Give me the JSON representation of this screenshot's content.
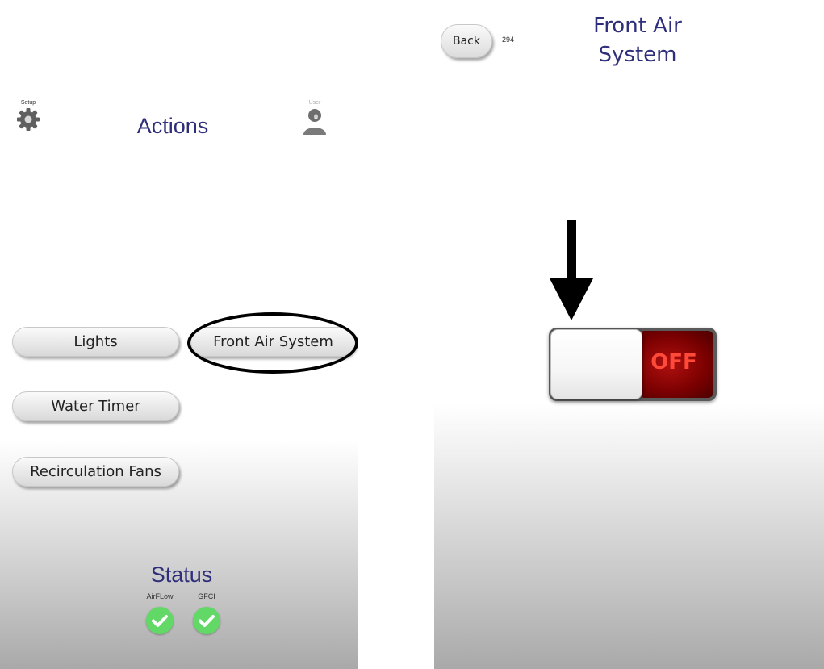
{
  "actions_screen": {
    "setup": {
      "caption": "Setup",
      "icon": "gear-icon"
    },
    "title": "Actions",
    "user": {
      "caption": "User",
      "icon": "user-icon",
      "badge": "0"
    },
    "buttons": [
      {
        "label": "Lights"
      },
      {
        "label": "Front Air System",
        "highlighted": true
      },
      {
        "label": "Water Timer"
      },
      {
        "label": "Recirculation Fans"
      }
    ],
    "status": {
      "title": "Status",
      "indicators": [
        {
          "label": "AirFLow",
          "icon": "check-icon",
          "color": "#62d867"
        },
        {
          "label": "GFCI",
          "icon": "check-icon",
          "color": "#62d867"
        }
      ]
    }
  },
  "detail_screen": {
    "back_label": "Back",
    "count": "294",
    "title_line1": "Front Air",
    "title_line2": "System",
    "toggle": {
      "state_label": "OFF",
      "on": false,
      "off_color": "#8b0000"
    },
    "annotation": {
      "icon": "down-arrow-icon"
    }
  },
  "colors": {
    "title_text": "#2e2e7a",
    "check_green": "#62d867"
  }
}
